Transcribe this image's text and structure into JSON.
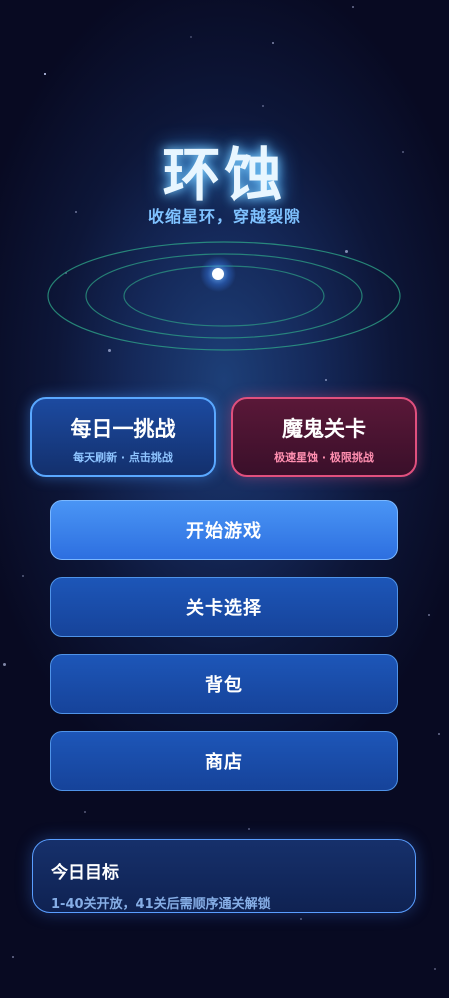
{
  "game": {
    "title": "环蚀",
    "subtitle": "收缩星环，穿越裂隙"
  },
  "modes": [
    {
      "label": "每日一挑战",
      "sub": "每天刷新 · 点击挑战",
      "accent": "#5aa8ff"
    },
    {
      "label": "魔鬼关卡",
      "sub": "极速星蚀 · 极限挑战",
      "accent": "#e0507e"
    }
  ],
  "menu": {
    "start": "开始游戏",
    "level_select": "关卡选择",
    "backpack": "背包",
    "shop": "商店"
  },
  "goal": {
    "title": "今日目标",
    "desc": "1-40关开放，41关后需顺序通关解锁"
  },
  "colors": {
    "ring": "#2fa889",
    "core": "#ffffff",
    "primary_button": "#3d86ee",
    "button": "#1a4daa"
  }
}
